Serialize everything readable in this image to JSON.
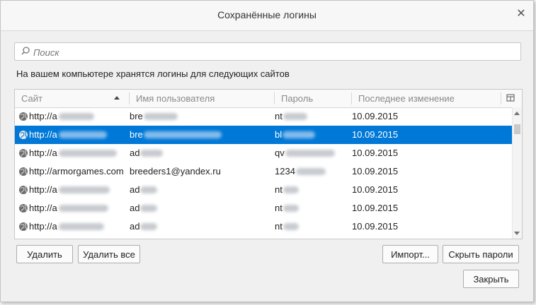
{
  "window": {
    "title": "Сохранённые логины",
    "close_glyph": "✕"
  },
  "search": {
    "placeholder": "Поиск",
    "value": ""
  },
  "intro_text": "На вашем компьютере хранятся логины для следующих сайтов",
  "table": {
    "columns": [
      "Сайт",
      "Имя пользователя",
      "Пароль",
      "Последнее изменение"
    ],
    "sort_column": "Сайт",
    "rows": [
      {
        "site": "http://a",
        "user": "bre",
        "password": "nt",
        "changed": "10.09.2015",
        "selected": false
      },
      {
        "site": "http://a",
        "user": "bre",
        "password": "bl",
        "changed": "10.09.2015",
        "selected": true
      },
      {
        "site": "http://a",
        "user": "ad",
        "password": "qv",
        "changed": "10.09.2015",
        "selected": false
      },
      {
        "site": "http://armorgames.com",
        "user": "breeders1@yandex.ru",
        "password": "1234",
        "changed": "10.09.2015",
        "selected": false
      },
      {
        "site": "http://a",
        "user": "ad",
        "password": "nt",
        "changed": "10.09.2015",
        "selected": false
      },
      {
        "site": "http://a",
        "user": "ad",
        "password": "nt",
        "changed": "10.09.2015",
        "selected": false
      },
      {
        "site": "http://a",
        "user": "ad",
        "password": "nt",
        "changed": "10.09.2015",
        "selected": false
      }
    ]
  },
  "buttons": {
    "delete": "Удалить",
    "delete_all": "Удалить все",
    "import": "Импорт...",
    "hide_passwords": "Скрыть пароли",
    "close": "Закрыть"
  },
  "colors": {
    "selection": "#0078d7",
    "background": "#f0f0f0"
  },
  "icons": {
    "row_icon": "globe-icon",
    "search": "search-icon",
    "column_picker": "column-picker-icon"
  }
}
